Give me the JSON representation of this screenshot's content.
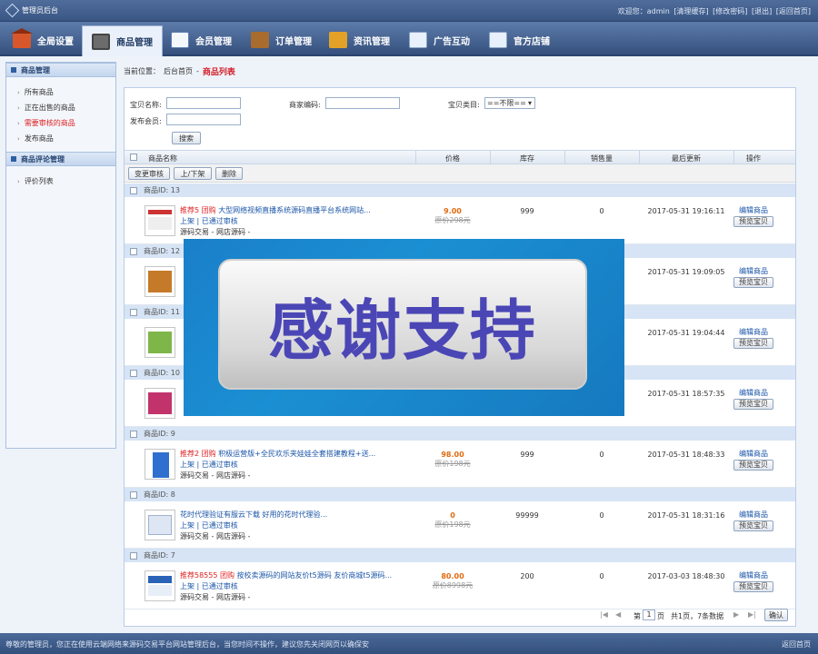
{
  "app": {
    "title": "管理员后台"
  },
  "top_links": {
    "welcome": "欢迎您：admin",
    "links": [
      "[清理缓存]",
      "[修改密码]",
      "[退出]",
      "[返回首页]"
    ]
  },
  "nav": [
    {
      "label": "全局设置",
      "icon": "home-icon"
    },
    {
      "label": "商品管理",
      "icon": "goods-icon",
      "active": true
    },
    {
      "label": "会员管理",
      "icon": "member-icon"
    },
    {
      "label": "订单管理",
      "icon": "order-icon"
    },
    {
      "label": "资讯管理",
      "icon": "info-icon"
    },
    {
      "label": "广告互动",
      "icon": "ad-icon"
    },
    {
      "label": "官方店铺",
      "icon": "shop-icon"
    }
  ],
  "sidebar": {
    "sections": [
      {
        "title": "商品管理",
        "items": [
          "所有商品",
          "正在出售的商品",
          "需要审核的商品",
          "发布商品"
        ],
        "highlight": 2
      },
      {
        "title": "商品评论管理",
        "items": [
          "评价列表"
        ]
      }
    ]
  },
  "breadcrumb": {
    "prefix": "当前位置：",
    "home": "后台首页",
    "sep": "-",
    "current": "商品列表"
  },
  "search": {
    "name_label": "宝贝名称:",
    "code_label": "商家编码:",
    "category_label": "宝贝类目:",
    "category_value": "==不限==",
    "member_label": "发布会员:",
    "button": "搜索"
  },
  "table": {
    "columns": [
      "商品名称",
      "价格",
      "库存",
      "销售量",
      "最后更新",
      "操作"
    ],
    "batch_buttons": [
      "变更审核",
      "上/下架",
      "删除"
    ],
    "rows": [
      {
        "id_label": "商品ID: 13",
        "tag": "推荐5 团购",
        "title": "大型网络视频直播系统源码直播平台系统网站...",
        "status": "上架 | 已通过审核",
        "source": "源码交易 - 网店源码 -",
        "price": "9.00",
        "orig": "原价298元",
        "stock": "999",
        "sales": "0",
        "updated": "2017-05-31 19:16:11"
      },
      {
        "id_label": "商品ID: 12",
        "tag": "",
        "title": "",
        "status": "",
        "source": "",
        "price": "",
        "orig": "",
        "stock": "",
        "sales": "",
        "updated": "2017-05-31 19:09:05"
      },
      {
        "id_label": "商品ID: 11",
        "tag": "",
        "title": "",
        "status": "",
        "source": "",
        "price": "",
        "orig": "",
        "stock": "",
        "sales": "",
        "updated": "2017-05-31 19:04:44"
      },
      {
        "id_label": "商品ID: 10",
        "tag": "",
        "title": "",
        "status": "",
        "source": "",
        "price": "",
        "orig": "",
        "stock": "",
        "sales": "",
        "updated": "2017-05-31 18:57:35"
      },
      {
        "id_label": "商品ID: 9",
        "tag": "推荐2 团购",
        "title": "积极运营版+全民欢乐夹娃娃全套搭建教程+送...",
        "status": "上架 | 已通过审核",
        "source": "源码交易 - 网店源码 -",
        "price": "98.00",
        "orig": "原价198元",
        "stock": "999",
        "sales": "0",
        "updated": "2017-05-31 18:48:33"
      },
      {
        "id_label": "商品ID: 8",
        "tag": "",
        "title": "花时代理验证有服云下载 好用的花时代理验...",
        "status": "上架 | 已通过审核",
        "source": "源码交易 - 网店源码 -",
        "price": "0",
        "orig": "原价198元",
        "stock": "99999",
        "sales": "0",
        "updated": "2017-05-31 18:31:16"
      },
      {
        "id_label": "商品ID: 7",
        "tag": "推荐58555 团购",
        "title": "按校卖源码的网站友价t5源码 友价商城t5源码...",
        "status": "上架 | 已通过审核",
        "source": "源码交易 - 网店源码 -",
        "price": "80.00",
        "orig": "原价8998元",
        "stock": "200",
        "sales": "0",
        "updated": "2017-03-03 18:48:30"
      }
    ],
    "op_edit": "编辑商品",
    "op_preview": "预览宝贝"
  },
  "pager": {
    "text_before": "第",
    "page": "1",
    "text_after": "页",
    "total": "共1页，7条数据",
    "confirm": "确认"
  },
  "overlay": {
    "text": "感谢支持"
  },
  "footer": {
    "notice": "尊敬的管理员，您正在使用云端网络来源码交易平台网站管理后台，当您时间不操作，建议您先关闭网页以确保安",
    "back": "返回首页"
  }
}
